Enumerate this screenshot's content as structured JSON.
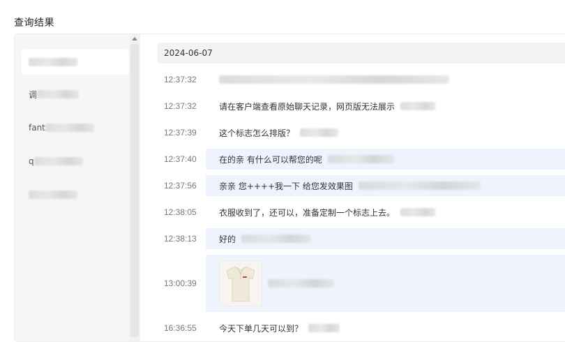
{
  "page": {
    "title": "查询结果"
  },
  "sidebar": {
    "items": [
      {
        "label": "",
        "blur_w": 70,
        "active": true
      },
      {
        "label": "调",
        "blur_w": 60,
        "active": false
      },
      {
        "label": "fant",
        "blur_w": 70,
        "active": false
      },
      {
        "label": "q",
        "blur_w": 70,
        "active": false
      },
      {
        "label": "",
        "blur_w": 70,
        "active": false
      }
    ]
  },
  "chat": {
    "date": "2024-06-07",
    "messages": [
      {
        "time": "12:37:32",
        "text": "",
        "blur_w": 330,
        "sent": false
      },
      {
        "time": "12:37:32",
        "text": "请在客户端查看原始聊天记录，网页版无法展示",
        "blur_w": 50,
        "sent": false
      },
      {
        "time": "12:37:39",
        "text": "这个标志怎么排版？",
        "blur_w": 55,
        "sent": false
      },
      {
        "time": "12:37:40",
        "text": "在的亲 有什么可以帮您的呢",
        "blur_w": 95,
        "sent": true
      },
      {
        "time": "12:37:56",
        "text": "亲亲 您++++我一下 给您发效果图",
        "blur_w": 175,
        "sent": true
      },
      {
        "time": "12:38:05",
        "text": "衣服收到了，还可以，准备定制一个标志上去。",
        "blur_w": 50,
        "sent": false
      },
      {
        "time": "12:38:13",
        "text": "好的",
        "blur_w": 100,
        "sent": true
      },
      {
        "time": "13:00:39",
        "text": "",
        "blur_w": 95,
        "sent": true,
        "image": "polo-shirt-image"
      },
      {
        "time": "16:36:55",
        "text": "今天下单几天可以到？",
        "blur_w": 45,
        "sent": false
      }
    ]
  }
}
